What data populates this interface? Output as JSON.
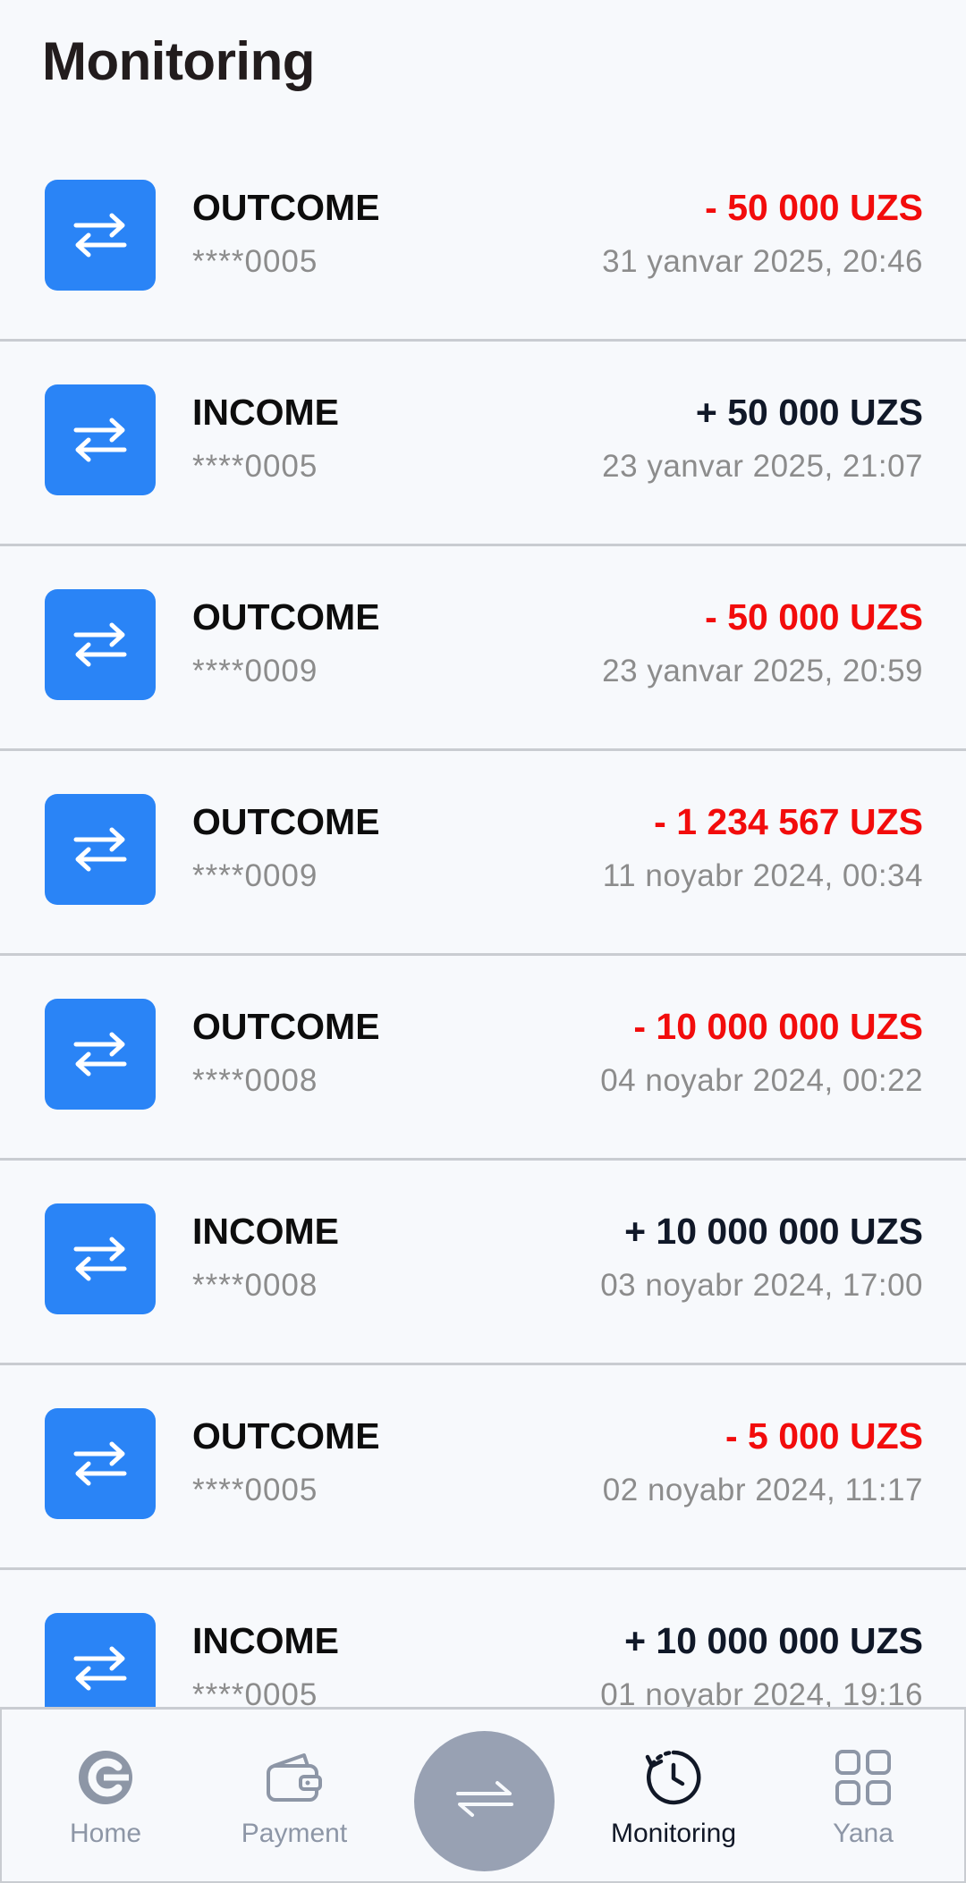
{
  "page": {
    "title": "Monitoring"
  },
  "colors": {
    "accent": "#2a84f6",
    "negative": "#f20c0c",
    "positive": "#101828",
    "muted": "#8c8c8c"
  },
  "transactions": [
    {
      "type": "OUTCOME",
      "card": "****0005",
      "amount": "- 50 000 UZS",
      "date": "31 yanvar 2025, 20:46",
      "negative": true
    },
    {
      "type": "INCOME",
      "card": "****0005",
      "amount": "+ 50 000 UZS",
      "date": "23 yanvar 2025, 21:07",
      "negative": false
    },
    {
      "type": "OUTCOME",
      "card": "****0009",
      "amount": "- 50 000 UZS",
      "date": "23 yanvar 2025, 20:59",
      "negative": true
    },
    {
      "type": "OUTCOME",
      "card": "****0009",
      "amount": "- 1 234 567 UZS",
      "date": "11 noyabr 2024, 00:34",
      "negative": true
    },
    {
      "type": "OUTCOME",
      "card": "****0008",
      "amount": "- 10 000 000 UZS",
      "date": "04 noyabr 2024, 00:22",
      "negative": true
    },
    {
      "type": "INCOME",
      "card": "****0008",
      "amount": "+ 10 000 000 UZS",
      "date": "03 noyabr 2024, 17:00",
      "negative": false
    },
    {
      "type": "OUTCOME",
      "card": "****0005",
      "amount": "- 5 000 UZS",
      "date": "02 noyabr 2024, 11:17",
      "negative": true
    },
    {
      "type": "INCOME",
      "card": "****0005",
      "amount": "+ 10 000 000 UZS",
      "date": "01 noyabr 2024, 19:16",
      "negative": false
    }
  ],
  "nav": {
    "home": {
      "label": "Home",
      "icon": "home-logo-icon"
    },
    "payment": {
      "label": "Payment",
      "icon": "wallet-icon"
    },
    "transfer": {
      "icon": "transfer-arrows-icon"
    },
    "monitoring": {
      "label": "Monitoring",
      "icon": "history-clock-icon",
      "active": true
    },
    "more": {
      "label": "Yana",
      "icon": "grid-icon"
    }
  }
}
